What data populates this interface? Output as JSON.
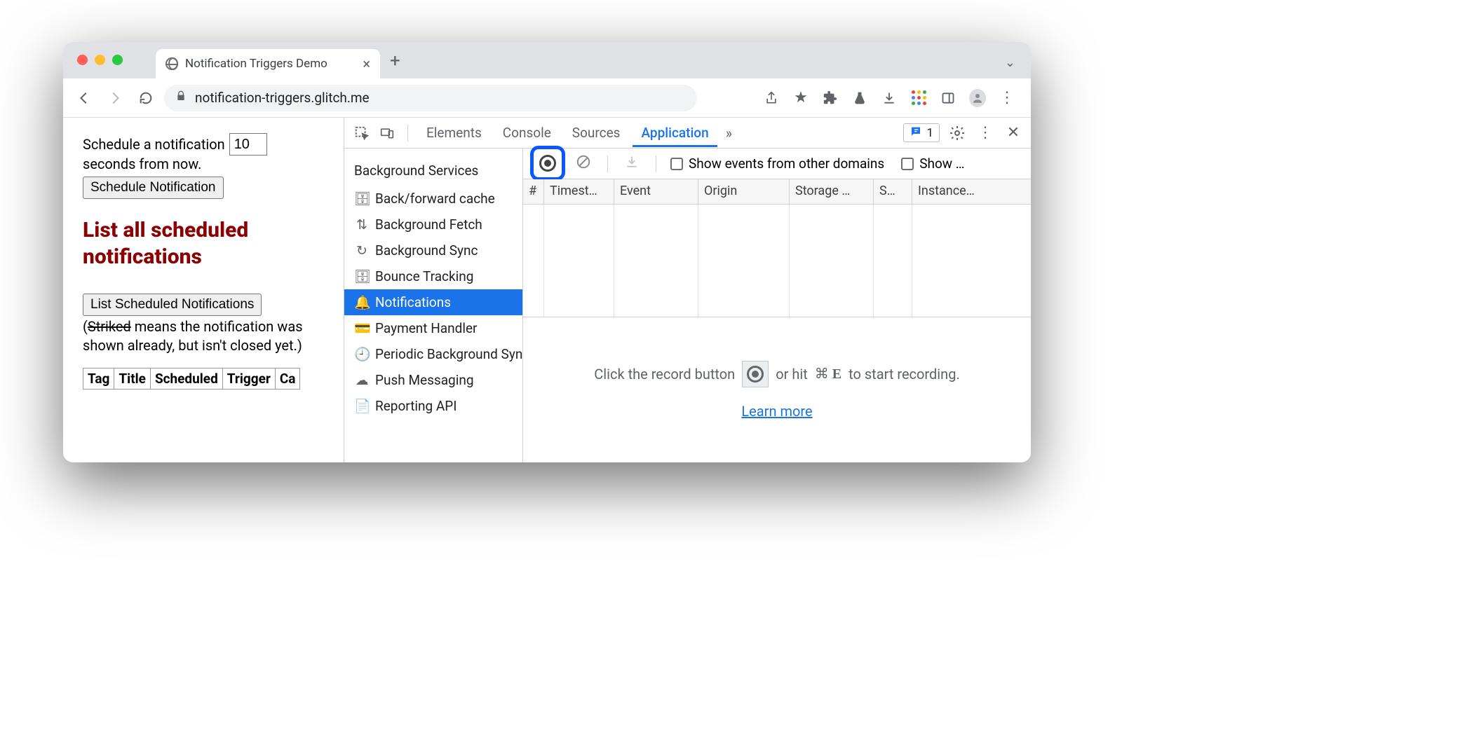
{
  "browser": {
    "tab_title": "Notification Triggers Demo",
    "url": "notification-triggers.glitch.me"
  },
  "page": {
    "schedule_prefix": "Schedule a notification",
    "schedule_value": "10",
    "schedule_suffix": "seconds from now.",
    "schedule_button": "Schedule Notification",
    "heading": "List all scheduled notifications",
    "list_button": "List Scheduled Notifications",
    "note_open": "(",
    "note_striked": "Striked",
    "note_rest": " means the notification was shown already, but isn't closed yet.)",
    "table_headers": [
      "Tag",
      "Title",
      "Scheduled",
      "Trigger",
      "Ca"
    ]
  },
  "devtools": {
    "tabs": {
      "elements": "Elements",
      "console": "Console",
      "sources": "Sources",
      "application": "Application"
    },
    "issue_count": "1",
    "sidebar": {
      "title": "Background Services",
      "items": [
        "Back/forward cache",
        "Background Fetch",
        "Background Sync",
        "Bounce Tracking",
        "Notifications",
        "Payment Handler",
        "Periodic Background Sync",
        "Push Messaging",
        "Reporting API"
      ]
    },
    "toolbar": {
      "show_other_domains": "Show events from other domains",
      "show_more": "Show …"
    },
    "columns": [
      "#",
      "Timest…",
      "Event",
      "Origin",
      "Storage …",
      "S…",
      "Instance…"
    ],
    "hint": {
      "pre": "Click the record button",
      "mid": "or hit",
      "shortcut": "⌘ E",
      "post": "to start recording.",
      "learn_more": "Learn more"
    }
  }
}
